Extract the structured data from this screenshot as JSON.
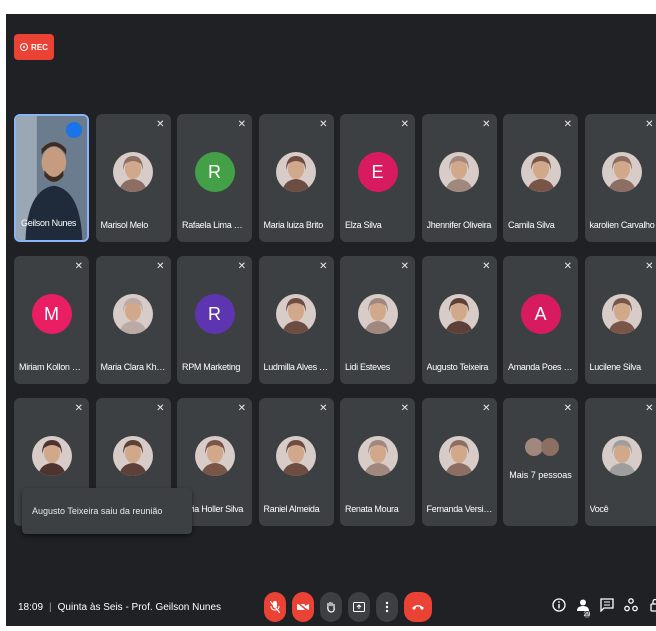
{
  "recording": {
    "label": "REC"
  },
  "participants": [
    {
      "name": "Geilson Nunes",
      "kind": "video"
    },
    {
      "name": "Marisol Melo",
      "kind": "photo",
      "color": "#8d6e63"
    },
    {
      "name": "Rafaela Lima Sou...",
      "kind": "initial",
      "initial": "R",
      "color": "#43a047"
    },
    {
      "name": "Maria luiza Brito",
      "kind": "photo",
      "color": "#6d4c41"
    },
    {
      "name": "Elza Silva",
      "kind": "initial",
      "initial": "E",
      "color": "#d81b60"
    },
    {
      "name": "Jhennifer Oliveira",
      "kind": "photo",
      "color": "#a1887f"
    },
    {
      "name": "Camila Silva",
      "kind": "photo",
      "color": "#795548"
    },
    {
      "name": "karolien Carvalho",
      "kind": "photo",
      "color": "#8d6e63"
    },
    {
      "name": "Miriam Kollon Me...",
      "kind": "initial",
      "initial": "M",
      "color": "#e91e63"
    },
    {
      "name": "Maria Clara Kho...",
      "kind": "photo",
      "color": "#bcaaa4"
    },
    {
      "name": "RPM Marketing",
      "kind": "initial",
      "initial": "R",
      "color": "#5e35b1"
    },
    {
      "name": "Ludmilla Alves Si...",
      "kind": "photo",
      "color": "#6d4c41"
    },
    {
      "name": "Lidi Esteves",
      "kind": "photo",
      "color": "#a1887f"
    },
    {
      "name": "Augusto Teixeira",
      "kind": "photo",
      "color": "#5d4037"
    },
    {
      "name": "Amanda Poes Sa...",
      "kind": "initial",
      "initial": "A",
      "color": "#d81b60"
    },
    {
      "name": "Lucilene Silva",
      "kind": "photo",
      "color": "#795548"
    },
    {
      "name": "",
      "kind": "photo",
      "color": "#4e342e"
    },
    {
      "name": "",
      "kind": "photo",
      "color": "#5d4037"
    },
    {
      "name": "Livia Holler Silva",
      "kind": "photo",
      "color": "#795548"
    },
    {
      "name": "Raniel Almeida",
      "kind": "photo",
      "color": "#6d4c41"
    },
    {
      "name": "Renata Moura",
      "kind": "photo",
      "color": "#a1887f"
    },
    {
      "name": "Fernanda Versiani",
      "kind": "photo",
      "color": "#8d6e63"
    },
    {
      "name": "Mais 7 pessoas",
      "kind": "more"
    },
    {
      "name": "Você",
      "kind": "photo",
      "color": "#9e9e9e"
    }
  ],
  "toast": {
    "text": "Augusto Teixeira saiu da reunião"
  },
  "bottom_bar": {
    "time": "18:09",
    "meeting_title": "Quinta às Seis - Prof. Geilson Nunes",
    "people_count": "29"
  }
}
